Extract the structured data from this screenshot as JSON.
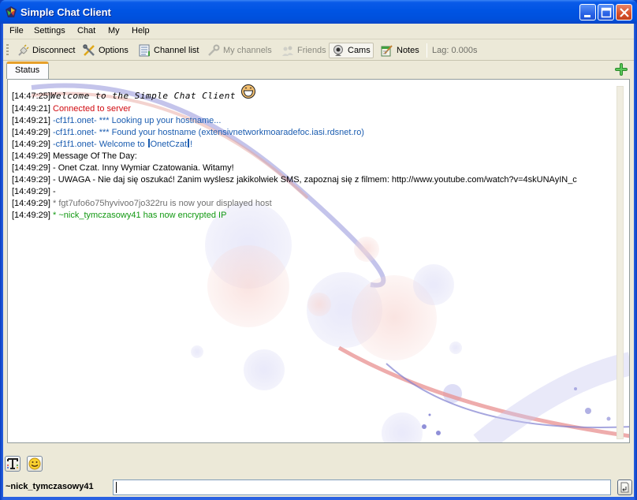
{
  "window": {
    "title": "Simple Chat Client",
    "controls": [
      "minimize",
      "maximize",
      "close"
    ]
  },
  "menu": {
    "items": [
      "File",
      "Settings",
      "Chat",
      "My",
      "Help"
    ]
  },
  "toolbar": {
    "disconnect": "Disconnect",
    "options": "Options",
    "channel_list": "Channel list",
    "my_channels": "My channels",
    "friends": "Friends",
    "cams": "Cams",
    "notes": "Notes",
    "lag": "Lag: 0.000s"
  },
  "tabs": {
    "items": [
      {
        "label": "Status",
        "active": true
      }
    ],
    "add_icon": "plus-icon"
  },
  "log": {
    "lines": [
      {
        "ts": "[14:47:25]",
        "text": "Welcome to the Simple Chat Client",
        "color": "black",
        "style": "welcome"
      },
      {
        "ts": "[14:49:21]",
        "text": "Connected to server",
        "color": "red"
      },
      {
        "ts": "[14:49:21]",
        "text": "-cf1f1.onet- *** Looking up your hostname...",
        "color": "blue"
      },
      {
        "ts": "[14:49:29]",
        "text": "-cf1f1.onet- *** Found your hostname (extensivnetworkmoaradefoc.iasi.rdsnet.ro)",
        "color": "blue"
      },
      {
        "ts": "[14:49:29]",
        "text_pre": "-cf1f1.onet- Welcome to ",
        "text_hl": "OnetCzat",
        "text_post": "!",
        "color": "blue"
      },
      {
        "ts": "[14:49:29]",
        "text": "Message Of The Day:",
        "color": "black"
      },
      {
        "ts": "[14:49:29]",
        "text": "- Onet Czat. Inny Wymiar Czatowania. Witamy!",
        "color": "black"
      },
      {
        "ts": "[14:49:29]",
        "text": "- UWAGA - Nie daj się oszukać! Zanim wyślesz jakikolwiek SMS, zapoznaj się z filmem: http://www.youtube.com/watch?v=4skUNAyIN_c",
        "color": "black"
      },
      {
        "ts": "[14:49:29]",
        "text": "-",
        "color": "black"
      },
      {
        "ts": "[14:49:29]",
        "text": "* fgt7ufo6o75hyvivoo7jo322ru is now your displayed host",
        "color": "gray"
      },
      {
        "ts": "[14:49:29]",
        "text": "* ~nick_tymczasowy41 has now encrypted IP",
        "color": "green"
      }
    ]
  },
  "format_bar": {
    "text_format_icon": "text-format-icon",
    "emoticon_icon": "smiley-icon"
  },
  "input": {
    "nick": "~nick_tymczasowy41",
    "value": "",
    "send_icon": "enter-icon"
  },
  "colors": {
    "titlebar": "#0054e3",
    "red": "#d00a10",
    "blue": "#1a5cb0",
    "gray": "#6f6f6f",
    "green": "#129912",
    "tab_accent": "#e6a02a"
  }
}
